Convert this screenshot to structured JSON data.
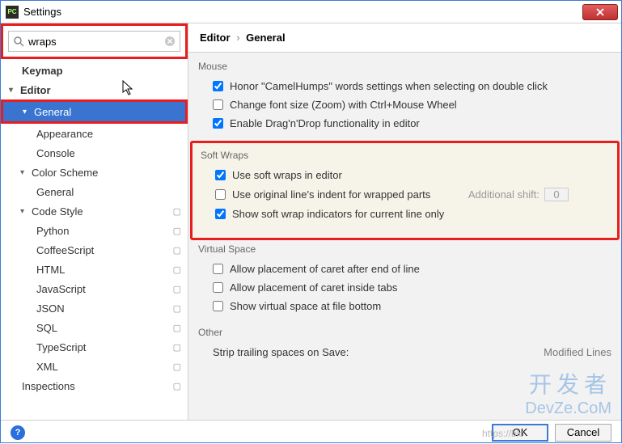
{
  "window": {
    "title": "Settings"
  },
  "search": {
    "value": "wraps"
  },
  "tree": {
    "keymap": "Keymap",
    "editor": "Editor",
    "general": "General",
    "appearance": "Appearance",
    "console": "Console",
    "color_scheme": "Color Scheme",
    "cs_general": "General",
    "code_style": "Code Style",
    "python": "Python",
    "coffeescript": "CoffeeScript",
    "html": "HTML",
    "javascript": "JavaScript",
    "json": "JSON",
    "sql": "SQL",
    "typescript": "TypeScript",
    "xml": "XML",
    "inspections": "Inspections"
  },
  "breadcrumb": {
    "root": "Editor",
    "leaf": "General"
  },
  "groups": {
    "mouse": {
      "title": "Mouse",
      "camelhumps": "Honor \"CamelHumps\" words settings when selecting on double click",
      "zoom": "Change font size (Zoom) with Ctrl+Mouse Wheel",
      "dnd": "Enable Drag'n'Drop functionality in editor"
    },
    "softwraps": {
      "title": "Soft Wraps",
      "use": "Use soft wraps in editor",
      "orig": "Use original line's indent for wrapped parts",
      "shift_label": "Additional shift:",
      "shift_value": "0",
      "indicators": "Show soft wrap indicators for current line only"
    },
    "virtual": {
      "title": "Virtual Space",
      "eol": "Allow placement of caret after end of line",
      "tabs": "Allow placement of caret inside tabs",
      "bottom": "Show virtual space at file bottom"
    },
    "other": {
      "title": "Other",
      "strip": "Strip trailing spaces on Save:",
      "strip_value": "Modified Lines"
    }
  },
  "buttons": {
    "ok": "OK",
    "cancel": "Cancel"
  },
  "watermark": {
    "cn": "开发者",
    "en": "DevZe.CoM",
    "url": "https://blo"
  }
}
